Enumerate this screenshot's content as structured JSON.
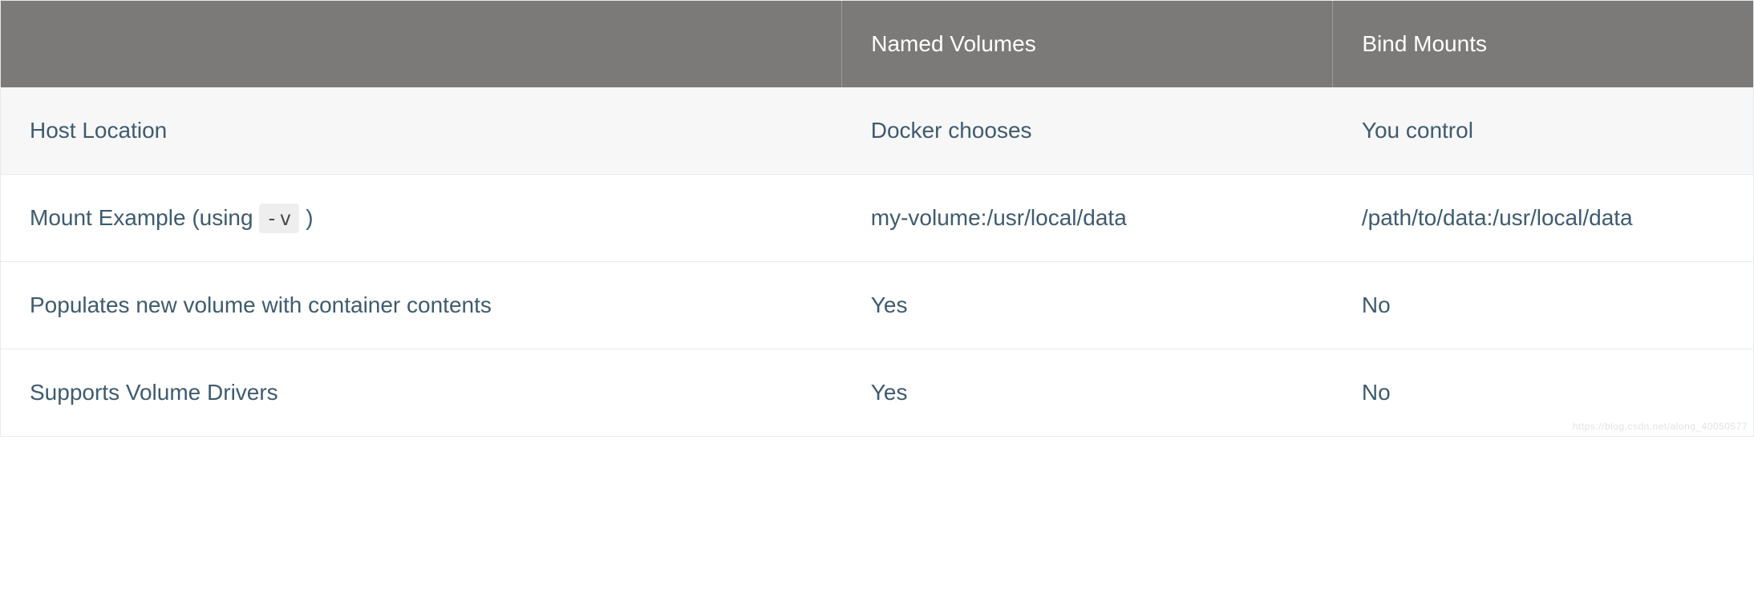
{
  "table": {
    "headers": [
      "",
      "Named Volumes",
      "Bind Mounts"
    ],
    "rows": [
      {
        "feature_prefix": "Host Location",
        "feature_code": "",
        "feature_suffix": "",
        "named": "Docker chooses",
        "bind": "You control",
        "alt": true
      },
      {
        "feature_prefix": "Mount Example (using ",
        "feature_code": "-v",
        "feature_suffix": " )",
        "named": "my-volume:/usr/local/data",
        "bind": "/path/to/data:/usr/local/data",
        "alt": false
      },
      {
        "feature_prefix": "Populates new volume with container contents",
        "feature_code": "",
        "feature_suffix": "",
        "named": "Yes",
        "bind": "No",
        "alt": false
      },
      {
        "feature_prefix": "Supports Volume Drivers",
        "feature_code": "",
        "feature_suffix": "",
        "named": "Yes",
        "bind": "No",
        "alt": false
      }
    ]
  },
  "watermark": "https://blog.csdn.net/along_40050577"
}
